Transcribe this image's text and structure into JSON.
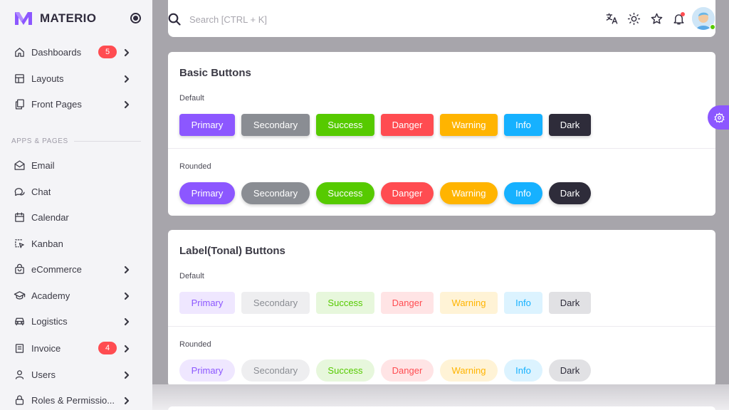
{
  "brand": {
    "name": "MATERIO",
    "accent": "#8c57ff"
  },
  "sidebar": {
    "items": [
      {
        "label": "Dashboards",
        "icon": "home-icon",
        "badge": "5",
        "has_chevron": true
      },
      {
        "label": "Layouts",
        "icon": "layout-icon",
        "has_chevron": true
      },
      {
        "label": "Front Pages",
        "icon": "pages-icon",
        "has_chevron": true
      }
    ],
    "section_title": "APPS & PAGES",
    "apps": [
      {
        "label": "Email",
        "icon": "mail-icon"
      },
      {
        "label": "Chat",
        "icon": "chat-icon"
      },
      {
        "label": "Calendar",
        "icon": "calendar-icon"
      },
      {
        "label": "Kanban",
        "icon": "kanban-icon"
      },
      {
        "label": "eCommerce",
        "icon": "cart-icon",
        "has_chevron": true
      },
      {
        "label": "Academy",
        "icon": "graduation-cap-icon",
        "has_chevron": true
      },
      {
        "label": "Logistics",
        "icon": "car-icon",
        "has_chevron": true
      },
      {
        "label": "Invoice",
        "icon": "invoice-icon",
        "badge": "4",
        "has_chevron": true
      },
      {
        "label": "Users",
        "icon": "user-icon",
        "has_chevron": true
      },
      {
        "label": "Roles & Permissio...",
        "icon": "lock-icon",
        "has_chevron": true
      }
    ]
  },
  "topbar": {
    "search_placeholder": "Search [CTRL + K]",
    "icons": [
      "search-icon",
      "translate-icon",
      "sun-icon",
      "star-icon",
      "bell-icon",
      "avatar"
    ]
  },
  "basic_buttons": {
    "title": "Basic Buttons",
    "default_label": "Default",
    "rounded_label": "Rounded",
    "buttons": [
      "Primary",
      "Secondary",
      "Success",
      "Danger",
      "Warning",
      "Info",
      "Dark"
    ]
  },
  "tonal_buttons": {
    "title": "Label(Tonal) Buttons",
    "default_label": "Default",
    "rounded_label": "Rounded",
    "buttons": [
      "Primary",
      "Secondary",
      "Success",
      "Danger",
      "Warning",
      "Info",
      "Dark"
    ]
  },
  "colors": {
    "primary": "#8c57ff",
    "secondary": "#8a8d93",
    "success": "#56ca00",
    "danger": "#ff4c51",
    "warning": "#ffb400",
    "info": "#16b1ff",
    "dark": "#2e2c3a"
  }
}
